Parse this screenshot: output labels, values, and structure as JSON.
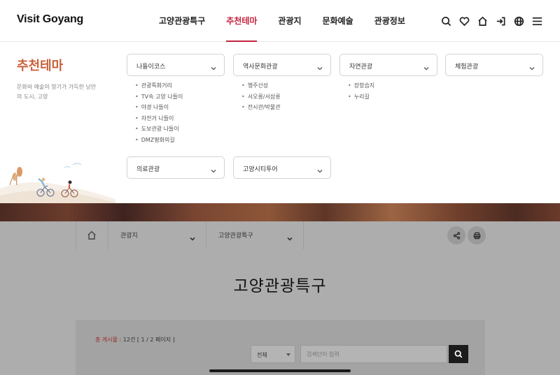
{
  "header": {
    "logo": "Visit Goyang",
    "nav": [
      "고양관광특구",
      "추천테마",
      "관광지",
      "문화예술",
      "관광정보"
    ],
    "active_nav": 1,
    "icons": [
      "search-icon",
      "heart-icon",
      "home-icon",
      "login-icon",
      "globe-icon",
      "menu-icon"
    ]
  },
  "panel": {
    "title": "추천테마",
    "desc": "문화와 예술의 향기가 가득한 낭만의 도시, 고양",
    "dropdowns": [
      {
        "label": "나들이코스",
        "items": [
          "관광특화거리",
          "TV속 고양 나들이",
          "야경 나들이",
          "자전거 나들이",
          "도보관광 나들이",
          "DMZ평화의길"
        ]
      },
      {
        "label": "역사문화관광",
        "items": [
          "행주산성",
          "서오릉/서삼릉",
          "전시관/박물관"
        ]
      },
      {
        "label": "자연관광",
        "items": [
          "장항습지",
          "누리길"
        ]
      },
      {
        "label": "체험관광",
        "items": []
      },
      {
        "label": "의료관광",
        "items": []
      },
      {
        "label": "고양시티투어",
        "items": []
      }
    ]
  },
  "breadcrumb": {
    "level1": "관광지",
    "level2": "고양관광특구"
  },
  "page": {
    "title": "고양관광특구"
  },
  "board": {
    "count_label": "총 게시물 :",
    "count_value": "12건",
    "page_info": "[ 1 / 2 페이지 ]",
    "select_value": "전체",
    "search_placeholder": "검색단어 입력"
  },
  "colors": {
    "accent": "#c4243f",
    "panel_title": "#c9603a"
  }
}
